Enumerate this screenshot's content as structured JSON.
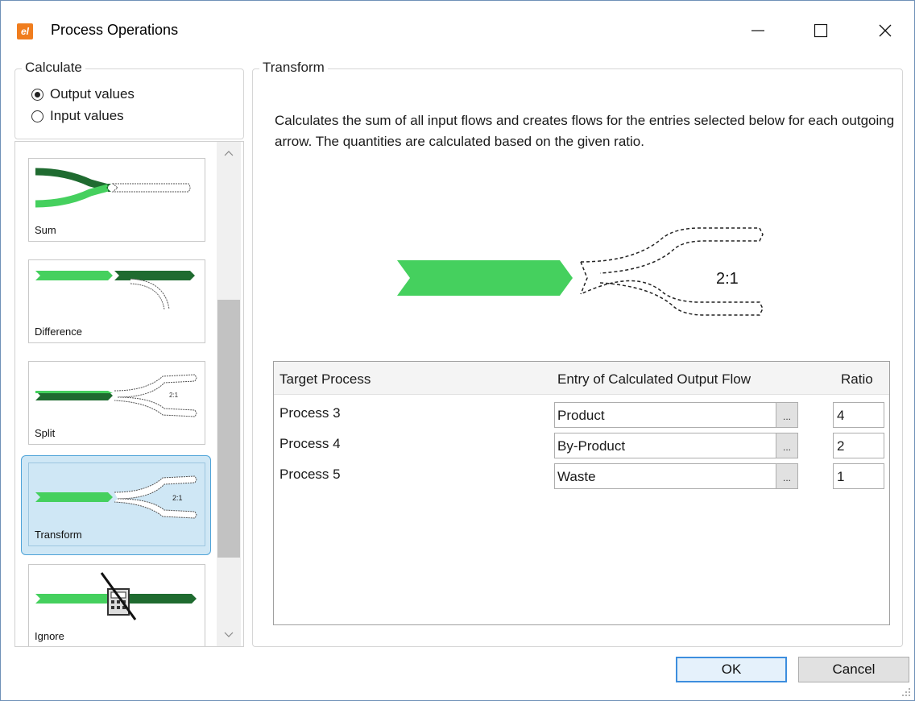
{
  "window": {
    "title": "Process Operations",
    "app_icon_letters": "el"
  },
  "calculate": {
    "legend": "Calculate",
    "options": [
      {
        "label": "Output values",
        "checked": true
      },
      {
        "label": "Input values",
        "checked": false
      }
    ]
  },
  "operations": [
    {
      "label": "Sum"
    },
    {
      "label": "Difference"
    },
    {
      "label": "Split",
      "ratio_text": "2:1"
    },
    {
      "label": "Transform",
      "ratio_text": "2:1",
      "selected": true
    },
    {
      "label": "Ignore"
    }
  ],
  "transform": {
    "legend": "Transform",
    "description": "Calculates the sum of all input flows and creates flows for the entries selected below for each outgoing arrow. The quantities are calculated based on the given ratio.",
    "diagram_ratio": "2:1",
    "table": {
      "headers": {
        "target": "Target Process",
        "entry": "Entry of Calculated Output Flow",
        "ratio": "Ratio"
      },
      "rows": [
        {
          "target": "Process 3",
          "entry": "Product",
          "ratio": "4"
        },
        {
          "target": "Process 4",
          "entry": "By-Product",
          "ratio": "2"
        },
        {
          "target": "Process 5",
          "entry": "Waste",
          "ratio": "1"
        }
      ],
      "browse_label": "..."
    }
  },
  "buttons": {
    "ok": "OK",
    "cancel": "Cancel"
  },
  "colors": {
    "light_green": "#45d05e",
    "dark_green": "#1f6b30",
    "selection_bg": "#cfe7f5",
    "selection_border": "#4ea3d8"
  }
}
